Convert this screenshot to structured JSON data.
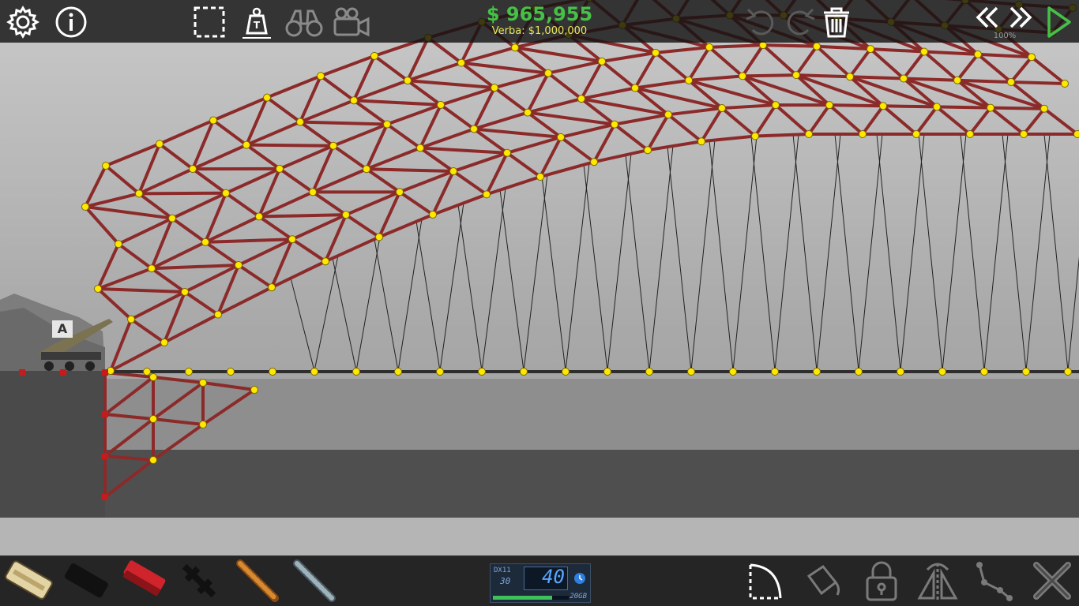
{
  "app": {
    "budget": "$ 965,955",
    "budget_label": "Verba: $1,000,000",
    "speed": "100%",
    "anchor_label": "A"
  },
  "toolbar": {
    "left": [
      "gear-icon",
      "info-icon",
      "select-box-icon",
      "weight-icon",
      "binoculars-icon",
      "camera-icon"
    ],
    "right": [
      "undo-icon",
      "redo-icon",
      "trash-icon",
      "rewind-icon",
      "fast-forward-icon",
      "play-icon"
    ]
  },
  "materials": [
    "road",
    "reinforced-road",
    "wood",
    "rope",
    "cable",
    "steel",
    "hydraulic"
  ],
  "bottom_tools": [
    "arc-icon",
    "paint-bucket-icon",
    "lock-icon",
    "mirror-icon",
    "split-joint-icon",
    "delete-icon"
  ],
  "hud": {
    "api_label": "DX11",
    "api_value": "30",
    "fps": "40",
    "memory": "20GB",
    "memory_fill": 0.78
  },
  "colors": {
    "accent_green": "#46c046",
    "budget_label": "#e8e85a",
    "beam": "#8c2a2a",
    "joint": "#ffe800",
    "anchor": "#c41c1c",
    "road": "#2e2e2e"
  }
}
